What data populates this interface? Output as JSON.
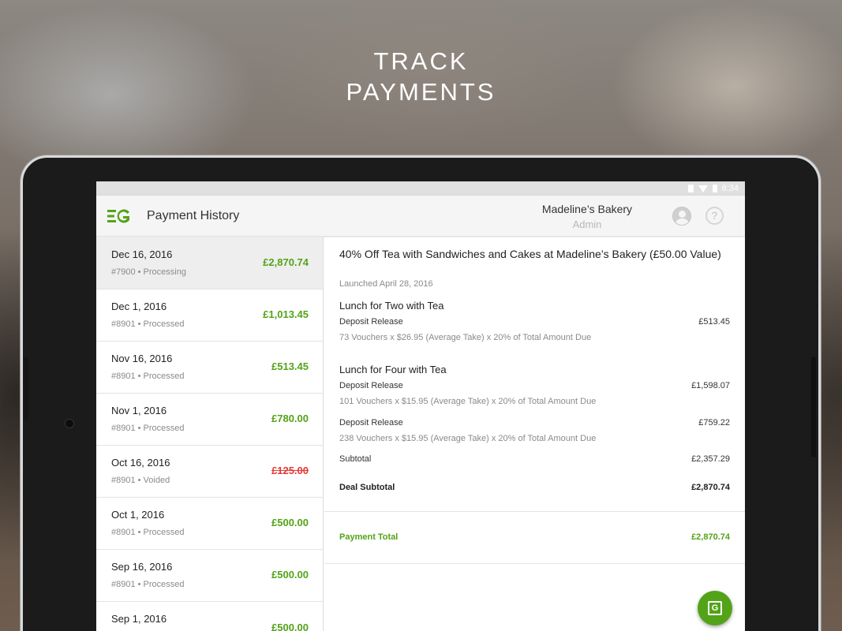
{
  "headline": {
    "line1": "TRACK",
    "line2": "PAYMENTS"
  },
  "statusbar": {
    "time": "8:34"
  },
  "appbar": {
    "title": "Payment History",
    "merchant_name": "Madeline’s Bakery",
    "merchant_role": "Admin",
    "help_label": "?"
  },
  "payments": [
    {
      "date": "Dec 16, 2016",
      "sub": "#7900 • Processing",
      "amount": "£2,870.74",
      "status": "processing"
    },
    {
      "date": "Dec 1, 2016",
      "sub": "#8901 • Processed",
      "amount": "£1,013.45",
      "status": "processed"
    },
    {
      "date": "Nov 16, 2016",
      "sub": "#8901 • Processed",
      "amount": "£513.45",
      "status": "processed"
    },
    {
      "date": "Nov 1, 2016",
      "sub": "#8901 • Processed",
      "amount": "£780.00",
      "status": "processed"
    },
    {
      "date": "Oct 16, 2016",
      "sub": "#8901 • Voided",
      "amount": "£125.00",
      "status": "voided"
    },
    {
      "date": "Oct 1, 2016",
      "sub": "#8901 • Processed",
      "amount": "£500.00",
      "status": "processed"
    },
    {
      "date": "Sep 16, 2016",
      "sub": "#8901 • Processed",
      "amount": "£500.00",
      "status": "processed"
    },
    {
      "date": "Sep 1, 2016",
      "sub": "",
      "amount": "£500.00",
      "status": "processed"
    }
  ],
  "detail": {
    "title": "40% Off Tea with Sandwiches and Cakes at Madeline’s Bakery (£50.00 Value)",
    "launched": "Launched April 28, 2016",
    "section1": {
      "name": "Lunch for Two with Tea",
      "rows": [
        {
          "label": "Deposit Release",
          "amount": "£513.45",
          "sub": "73 Vouchers x $26.95 (Average Take) x 20% of Total Amount Due"
        }
      ]
    },
    "section2": {
      "name": "Lunch for Four with Tea",
      "rows": [
        {
          "label": "Deposit Release",
          "amount": "£1,598.07",
          "sub": "101 Vouchers x $15.95 (Average Take) x 20% of Total Amount Due"
        },
        {
          "label": "Deposit Release",
          "amount": "£759.22",
          "sub": "238 Vouchers x $15.95 (Average Take) x 20% of Total Amount Due"
        }
      ]
    },
    "subtotal": {
      "label": "Subtotal",
      "amount": "£2,357.29"
    },
    "deal_subtotal": {
      "label": "Deal Subtotal",
      "amount": "£2,870.74"
    },
    "payment_total": {
      "label": "Payment Total",
      "amount": "£2,870.74"
    }
  },
  "fab": {
    "label": "G"
  },
  "colors": {
    "accent": "#53a318",
    "voided": "#e53935"
  }
}
